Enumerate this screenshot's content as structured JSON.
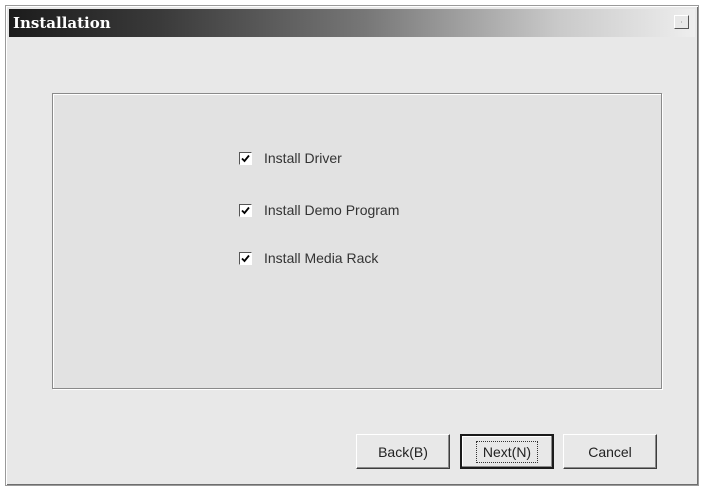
{
  "window": {
    "title": "Installation",
    "close_label": "×"
  },
  "options": [
    {
      "label": "Install Driver",
      "checked": true
    },
    {
      "label": "Install Demo Program",
      "checked": true
    },
    {
      "label": "Install Media Rack",
      "checked": true
    }
  ],
  "buttons": {
    "back_label": "Back(B)",
    "next_label": "Next(N)",
    "cancel_label": "Cancel"
  }
}
